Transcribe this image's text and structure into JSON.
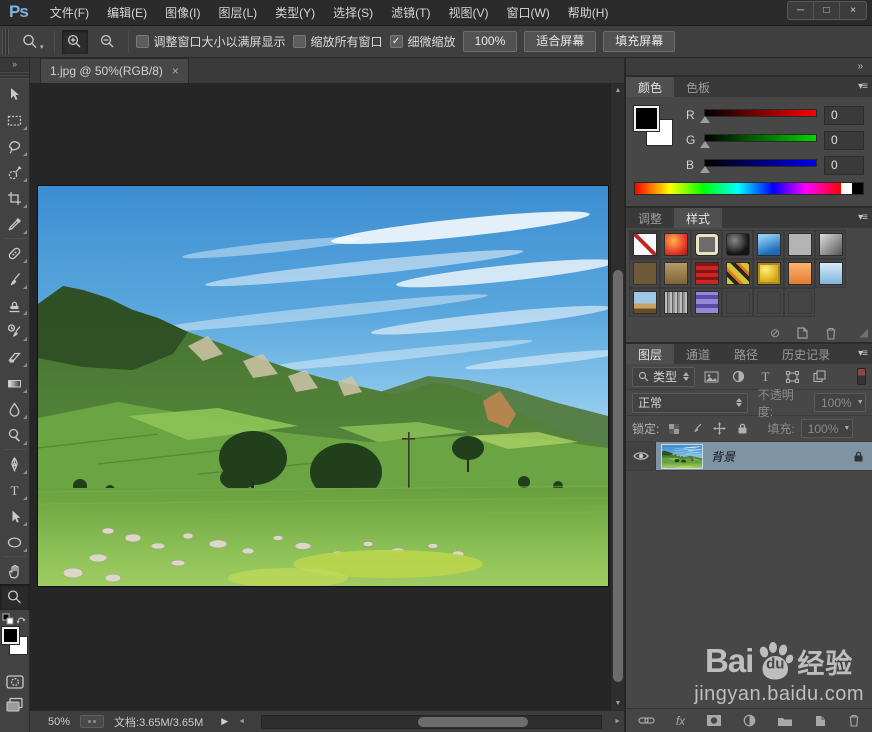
{
  "app": {
    "logo": "Ps",
    "controls": {
      "minimize": "─",
      "maximize": "□",
      "close": "×"
    }
  },
  "menu": {
    "items": [
      "文件(F)",
      "编辑(E)",
      "图像(I)",
      "图层(L)",
      "类型(Y)",
      "选择(S)",
      "滤镜(T)",
      "视图(V)",
      "窗口(W)",
      "帮助(H)"
    ]
  },
  "options": {
    "resize_windows_label": "调整窗口大小以满屏显示",
    "zoom_all_label": "缩放所有窗口",
    "scrubby_zoom_label": "细微缩放",
    "actual_pixels_label": "100%",
    "fit_screen_label": "适合屏幕",
    "fill_screen_label": "填充屏幕"
  },
  "document": {
    "tab_title": "1.jpg @ 50%(RGB/8)",
    "close": "×",
    "zoom_level": "50%",
    "doc_info": "文档:3.65M/3.65M"
  },
  "panels": {
    "color": {
      "tab_color": "颜色",
      "tab_swatches": "色板",
      "r_label": "R",
      "r_value": "0",
      "g_label": "G",
      "g_value": "0",
      "b_label": "B",
      "b_value": "0"
    },
    "styles": {
      "tab_adjustments": "调整",
      "tab_styles": "样式"
    },
    "layers": {
      "tab_layers": "图层",
      "tab_channels": "通道",
      "tab_paths": "路径",
      "tab_history": "历史记录",
      "filter_type": "类型",
      "blend_mode": "正常",
      "opacity_label": "不透明度:",
      "opacity_value": "100%",
      "lock_label": "锁定:",
      "fill_label": "填充:",
      "fill_value": "100%",
      "layer_name": "背景",
      "fx_label": "fx"
    }
  },
  "watermark": {
    "bai": "Bai",
    "du": "du",
    "suffix": "经验",
    "url": "jingyan.baidu.com"
  },
  "icons": {
    "collapse": "»",
    "panel_menu": "▾≡",
    "check": "✓",
    "caret_down": "▼",
    "play": "▶",
    "arrow_up": "▲",
    "arrow_down": "▼",
    "arrow_left": "◄",
    "arrow_right": "►",
    "no_symbol": "⊘",
    "minimize": "─"
  },
  "colors": {
    "logo_blue": "#7fb2df",
    "selected_layer": "#7e93a4",
    "panel_bg": "#474747",
    "window_bg": "#2b2b2b",
    "slider_red": "#ff0000",
    "slider_green": "#00d800",
    "slider_blue": "#0000f0",
    "sky_top": "#3d8ed2",
    "field_green": "#6aa443"
  }
}
